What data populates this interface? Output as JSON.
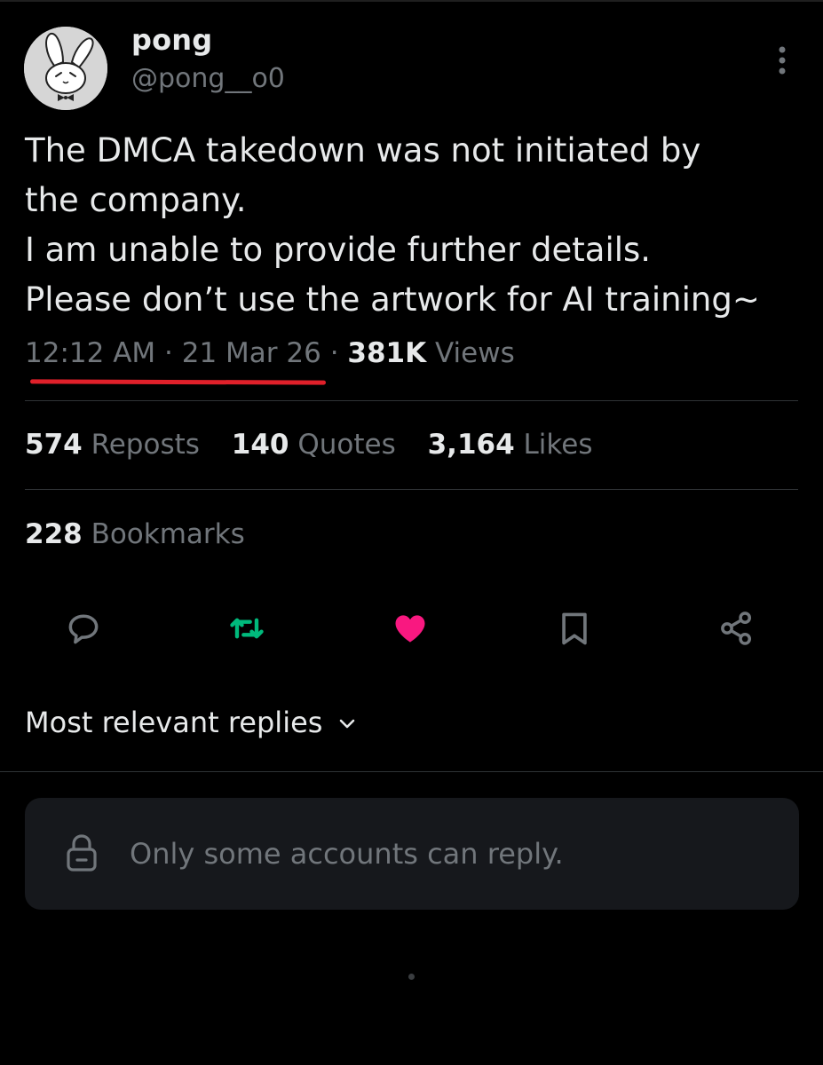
{
  "author": {
    "display_name": "pong",
    "handle": "@pong__o0",
    "avatar_icon": "bunny-avatar"
  },
  "tweet": {
    "lines": [
      "The DMCA takedown was not initiated by",
      "the company.",
      "I am unable to provide further details.",
      "Please don’t use the artwork for AI training~"
    ],
    "time": "12:12 AM",
    "date": "21 Mar 26",
    "views_count": "381K",
    "views_label": "Views",
    "separator": "·"
  },
  "stats": {
    "reposts_count": "574",
    "reposts_label": "Reposts",
    "quotes_count": "140",
    "quotes_label": "Quotes",
    "likes_count": "3,164",
    "likes_label": "Likes",
    "bookmarks_count": "228",
    "bookmarks_label": "Bookmarks"
  },
  "actions": [
    {
      "name": "reply-icon",
      "color": "#71767b"
    },
    {
      "name": "repost-icon",
      "color": "#00ba7c"
    },
    {
      "name": "like-icon",
      "color": "#f91880"
    },
    {
      "name": "bookmark-icon",
      "color": "#71767b"
    },
    {
      "name": "share-icon",
      "color": "#71767b"
    }
  ],
  "replies": {
    "sort_label": "Most relevant replies",
    "restriction_text": "Only some accounts can reply."
  },
  "colors": {
    "background": "#000000",
    "text_primary": "#e7e9ea",
    "text_secondary": "#71767b",
    "annotation_underline": "#e0202a",
    "liked": "#f91880",
    "reposted": "#00ba7c"
  }
}
